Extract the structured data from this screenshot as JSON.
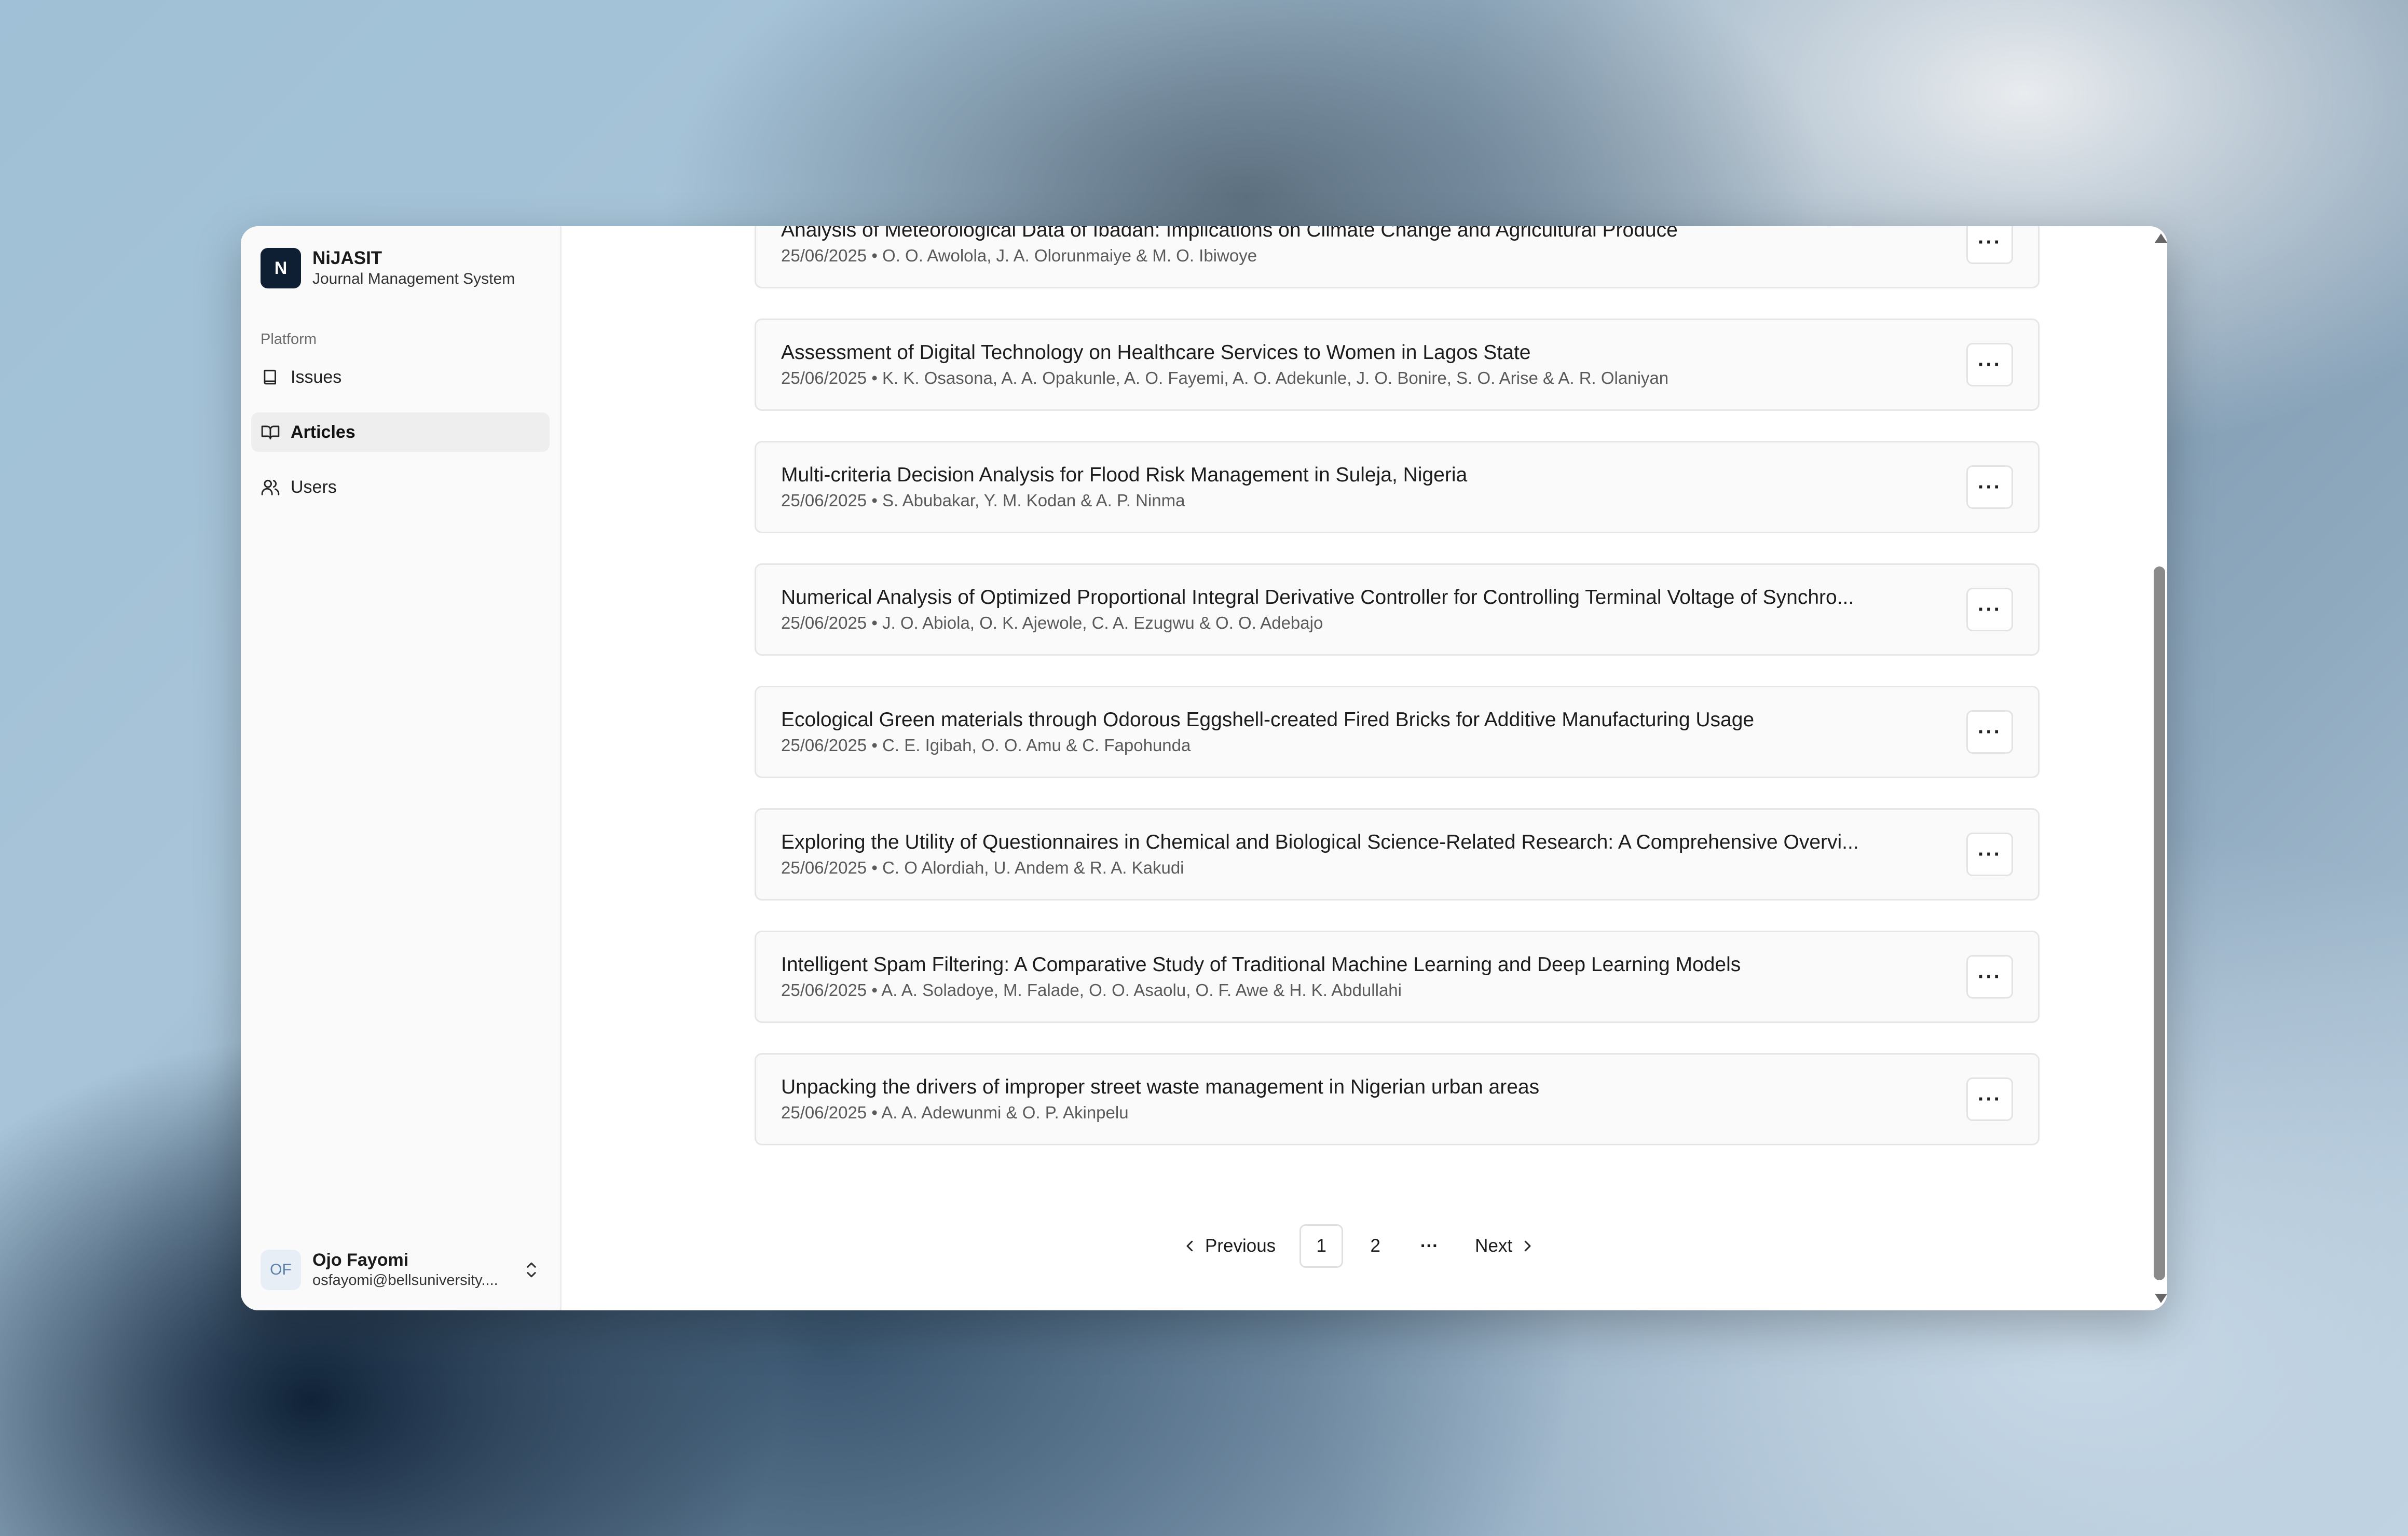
{
  "app": {
    "name": "NiJASIT",
    "subtitle": "Journal Management System",
    "logo_letter": "N"
  },
  "sidebar": {
    "section_label": "Platform",
    "items": [
      {
        "label": "Issues",
        "icon": "book-icon",
        "active": false
      },
      {
        "label": "Articles",
        "icon": "book-open-icon",
        "active": true
      },
      {
        "label": "Users",
        "icon": "users-icon",
        "active": false
      }
    ]
  },
  "user": {
    "initials": "OF",
    "name": "Ojo Fayomi",
    "email": "osfayomi@bellsuniversity...."
  },
  "articles": [
    {
      "title": "Analysis of Meteorological Data of Ibadan: Implications on Climate Change and Agricultural Produce",
      "meta": "25/06/2025 • O. O. Awolola, J. A. Olorunmaiye & M. O. Ibiwoye"
    },
    {
      "title": "Assessment of Digital Technology on Healthcare Services to Women in Lagos State",
      "meta": "25/06/2025 • K. K. Osasona, A. A. Opakunle, A. O. Fayemi, A. O. Adekunle, J. O. Bonire, S. O. Arise & A. R. Olaniyan"
    },
    {
      "title": "Multi-criteria Decision Analysis for Flood Risk Management in Suleja, Nigeria",
      "meta": "25/06/2025 • S. Abubakar, Y. M. Kodan & A. P. Ninma"
    },
    {
      "title": "Numerical Analysis of Optimized Proportional Integral Derivative Controller for Controlling Terminal Voltage of Synchro...",
      "meta": "25/06/2025 • J. O. Abiola, O. K. Ajewole, C. A. Ezugwu & O. O. Adebajo"
    },
    {
      "title": "Ecological Green materials through Odorous Eggshell-created Fired Bricks for Additive Manufacturing Usage",
      "meta": "25/06/2025 • C. E. Igibah, O. O. Amu & C. Fapohunda"
    },
    {
      "title": "Exploring the Utility of Questionnaires in Chemical and Biological Science-Related Research: A Comprehensive Overvi...",
      "meta": "25/06/2025 • C. O Alordiah, U. Andem & R. A. Kakudi"
    },
    {
      "title": "Intelligent Spam Filtering: A Comparative Study of Traditional Machine Learning and Deep Learning Models",
      "meta": "25/06/2025 • A. A. Soladoye, M. Falade, O. O. Asaolu, O. F. Awe & H. K. Abdullahi"
    },
    {
      "title": "Unpacking the drivers of improper street waste management in Nigerian urban areas",
      "meta": "25/06/2025 • A. A. Adewunmi & O. P. Akinpelu"
    }
  ],
  "more_label": "···",
  "pagination": {
    "previous": "Previous",
    "pages": [
      "1",
      "2"
    ],
    "current": "1",
    "ellipsis": "···",
    "next": "Next"
  }
}
